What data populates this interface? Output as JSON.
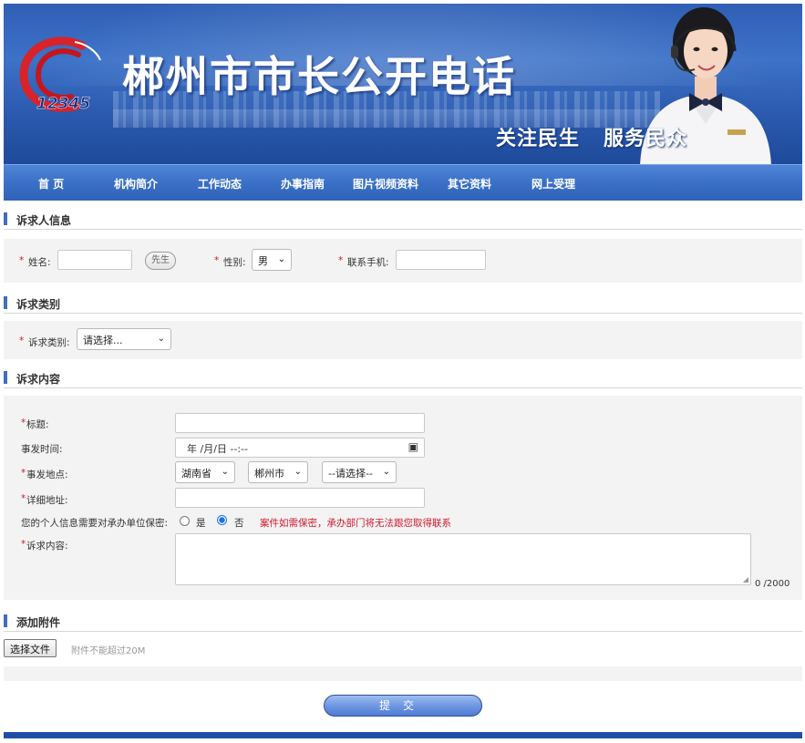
{
  "header": {
    "logo_number": "12345",
    "title": "郴州市市长公开电话",
    "slogan": "关注民生   服务民众"
  },
  "nav": {
    "items": [
      "首  页",
      "机构简介",
      "工作动态",
      "办事指南",
      "图片视频资料",
      "其它资料",
      "网上受理"
    ]
  },
  "sections": {
    "requester": "诉求人信息",
    "category": "诉求类别",
    "content": "诉求内容",
    "attachment": "添加附件"
  },
  "requester": {
    "required_mark": "*",
    "name_label": "姓名:",
    "name_value": "",
    "title_button": "先生",
    "gender_label": "性别:",
    "gender_value": "男",
    "phone_label": "联系手机:",
    "phone_value": ""
  },
  "category": {
    "label": "诉求类别:",
    "value": "请选择..."
  },
  "content": {
    "title_label": "标题:",
    "title_value": "",
    "time_label": "事发时间:",
    "time_value": "年 /月/日  --:--",
    "location_label": "事发地点:",
    "province": "湖南省",
    "city": "郴州市",
    "district": "--请选择--",
    "address_label": "详细地址:",
    "address_value": "",
    "privacy_label": "您的个人信息需要对承办单位保密:",
    "privacy_yes": "是",
    "privacy_no": "否",
    "privacy_selected": "否",
    "privacy_warning": "案件如需保密，承办部门将无法跟您取得联系",
    "body_label": "诉求内容:",
    "counter": "0 /2000"
  },
  "attachment": {
    "button": "选择文件",
    "hint": "附件不能超过20M"
  },
  "submit_label": "提交",
  "colors": {
    "banner_blue": "#2f5fb5",
    "nav_blue": "#3a70c6",
    "required_red": "#d0182b",
    "footer_blue": "#1e4fa8"
  }
}
